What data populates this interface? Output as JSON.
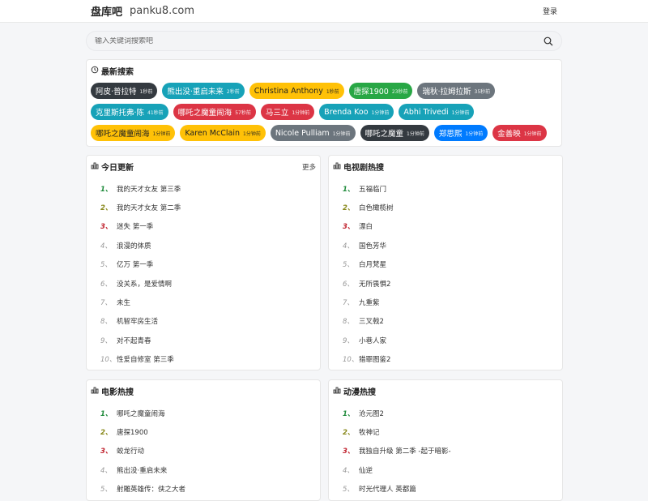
{
  "header": {
    "brand": "盘库吧",
    "domain": "panku8.com",
    "login": "登录"
  },
  "search": {
    "placeholder": "输入关键词搜索吧"
  },
  "recent": {
    "title": "最新搜索",
    "tags": [
      {
        "label": "阿皮·普拉特",
        "time": "1秒前",
        "color": "#343a40"
      },
      {
        "label": "熊出没·重启未来",
        "time": "2秒前",
        "color": "#17a2b8"
      },
      {
        "label": "Christina Anthony",
        "time": "1秒前",
        "color": "#ffc107",
        "dark": true
      },
      {
        "label": "唐探1900",
        "time": "23秒前",
        "color": "#28a745"
      },
      {
        "label": "瑞秋·拉姆拉斯",
        "time": "35秒前",
        "color": "#6c757d"
      },
      {
        "label": "克里斯托弗·陈",
        "time": "41秒前",
        "color": "#17a2b8"
      },
      {
        "label": "哪吒之魔童闹海",
        "time": "57秒前",
        "color": "#dc3545"
      },
      {
        "label": "马三立",
        "time": "1分钟前",
        "color": "#dc3545"
      },
      {
        "label": "Brenda Koo",
        "time": "1分钟前",
        "color": "#17a2b8"
      },
      {
        "label": "Abhi Trivedi",
        "time": "1分钟前",
        "color": "#17a2b8"
      },
      {
        "label": "哪吒之魔童闹海",
        "time": "1分钟前",
        "color": "#ffc107",
        "dark": true
      },
      {
        "label": "Karen McClain",
        "time": "1分钟前",
        "color": "#ffc107",
        "dark": true
      },
      {
        "label": "Nicole Pulliam",
        "time": "1分钟前",
        "color": "#6c757d"
      },
      {
        "label": "哪吒之魔童",
        "time": "1分钟前",
        "color": "#343a40"
      },
      {
        "label": "郑思熙",
        "time": "1分钟前",
        "color": "#007bff"
      },
      {
        "label": "金善映",
        "time": "1分钟前",
        "color": "#dc3545"
      }
    ]
  },
  "today": {
    "title": "今日更新",
    "more": "更多",
    "items": [
      "我的天才女友 第三季",
      "我的天才女友 第二季",
      "迷失 第一季",
      "浪漫的体质",
      "亿万 第一季",
      "没关系，是爱情啊",
      "未生",
      "机智牢房生活",
      "对不起青春",
      "性爱自修室 第三季"
    ]
  },
  "tv": {
    "title": "电视剧热搜",
    "items": [
      "五福临门",
      "白色橄榄树",
      "漂白",
      "国色芳华",
      "白月梵星",
      "无所畏惧2",
      "九重紫",
      "三叉戟2",
      "小巷人家",
      "猎罪图鉴2"
    ]
  },
  "movie": {
    "title": "电影热搜",
    "items": [
      "哪吒之魔童闹海",
      "唐探1900",
      "蛟龙行动",
      "熊出没·重启未来",
      "射雕英雄传：侠之大者"
    ]
  },
  "anime": {
    "title": "动漫热搜",
    "items": [
      "沧元图2",
      "牧神记",
      "我独自升级 第二季 -起于暗影-",
      "仙逆",
      "时光代理人 英都篇"
    ]
  }
}
